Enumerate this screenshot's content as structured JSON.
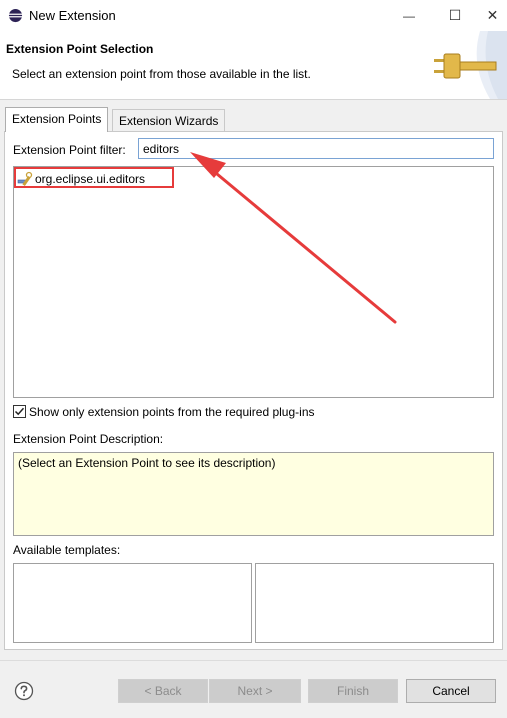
{
  "window": {
    "title": "New Extension",
    "minimize_glyph": "—",
    "maximize_glyph": "☐",
    "close_glyph": "✕"
  },
  "banner": {
    "title": "Extension Point Selection",
    "message": "Select an extension point from those available in the list."
  },
  "tabs": [
    {
      "label": "Extension Points",
      "selected": true
    },
    {
      "label": "Extension Wizards",
      "selected": false
    }
  ],
  "filter": {
    "label": "Extension Point filter:",
    "value": "editors"
  },
  "tree": {
    "items": [
      {
        "label": "org.eclipse.ui.editors",
        "icon": "extension-point-icon"
      }
    ]
  },
  "show_only": {
    "label": "Show only extension points from the required plug-ins",
    "checked": true
  },
  "description": {
    "label": "Extension Point Description:",
    "text": "(Select an Extension Point to see its description)"
  },
  "templates": {
    "label": "Available templates:"
  },
  "buttons": {
    "back": "< Back",
    "next": "Next >",
    "finish": "Finish",
    "cancel": "Cancel"
  },
  "icons": {
    "app": "eclipse-icon",
    "banner": "plug-icon",
    "help": "help-icon"
  },
  "colors": {
    "annotation": "#e63b3b",
    "description_bg": "#ffffe1",
    "focus_border": "#7aa3d4"
  }
}
